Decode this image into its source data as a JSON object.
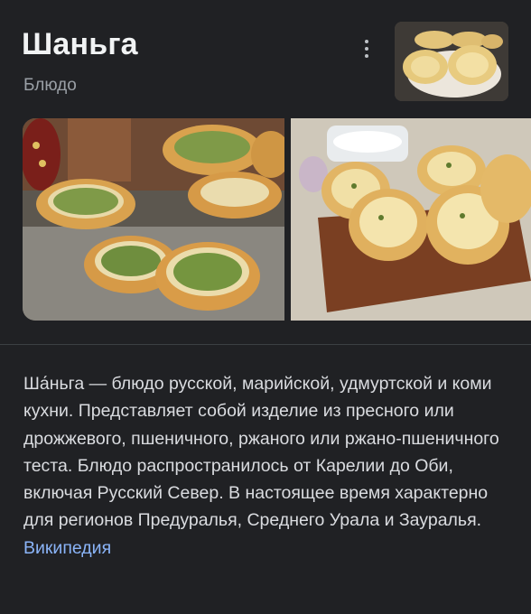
{
  "header": {
    "title": "Шаньга",
    "subtitle": "Блюдо"
  },
  "images": {
    "thumbnail": "shanga-thumbnail",
    "gallery": [
      "shanga-greens-photo",
      "shanga-board-photo"
    ]
  },
  "description": {
    "text": "Ша́ньга — блюдо русской, марийской, удмуртской и коми кухни. Представляет собой изделие из пресного или дрожжевого, пшеничного, ржаного или ржано-пшеничного теста. Блюдо распространилось от Карелии до Оби, включая Русский Север. В настоящее время характерно для регионов Предуралья, Среднего Урала и Зауралья.",
    "source_link": "Википедия"
  },
  "colors": {
    "background": "#202124",
    "link": "#8ab4f8",
    "muted": "#9aa0a6"
  }
}
